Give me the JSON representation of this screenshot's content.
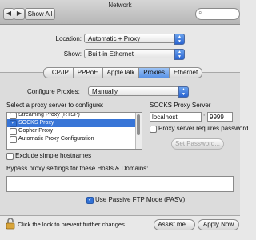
{
  "window": {
    "title": "Network"
  },
  "toolbar": {
    "back": "◀",
    "forward": "▶",
    "show_all": "Show All"
  },
  "location": {
    "label": "Location:",
    "value": "Automatic + Proxy"
  },
  "show": {
    "label": "Show:",
    "value": "Built-in Ethernet"
  },
  "tabs": [
    "TCP/IP",
    "PPPoE",
    "AppleTalk",
    "Proxies",
    "Ethernet"
  ],
  "configure": {
    "label": "Configure Proxies:",
    "value": "Manually"
  },
  "proxy_list": {
    "heading": "Select a proxy server to configure:",
    "items": [
      {
        "label": "Streaming Proxy (RTSP)",
        "checked": false
      },
      {
        "label": "SOCKS Proxy",
        "checked": true
      },
      {
        "label": "Gopher Proxy",
        "checked": false
      },
      {
        "label": "Automatic Proxy Configuration",
        "checked": false
      }
    ]
  },
  "socks": {
    "heading": "SOCKS Proxy Server",
    "host": "localhost",
    "colon": ":",
    "port": "9999",
    "requires_password": "Proxy server requires password",
    "set_password": "Set Password..."
  },
  "exclude_simple": "Exclude simple hostnames",
  "bypass": {
    "label": "Bypass proxy settings for these Hosts & Domains:",
    "value": ""
  },
  "passive_ftp": "Use Passive FTP Mode (PASV)",
  "footer": {
    "lock_text": "Click the lock to prevent further changes.",
    "assist": "Assist me...",
    "apply": "Apply Now"
  },
  "colors": {
    "accent": "#3875d7",
    "tab_active": "#5a93e6"
  }
}
